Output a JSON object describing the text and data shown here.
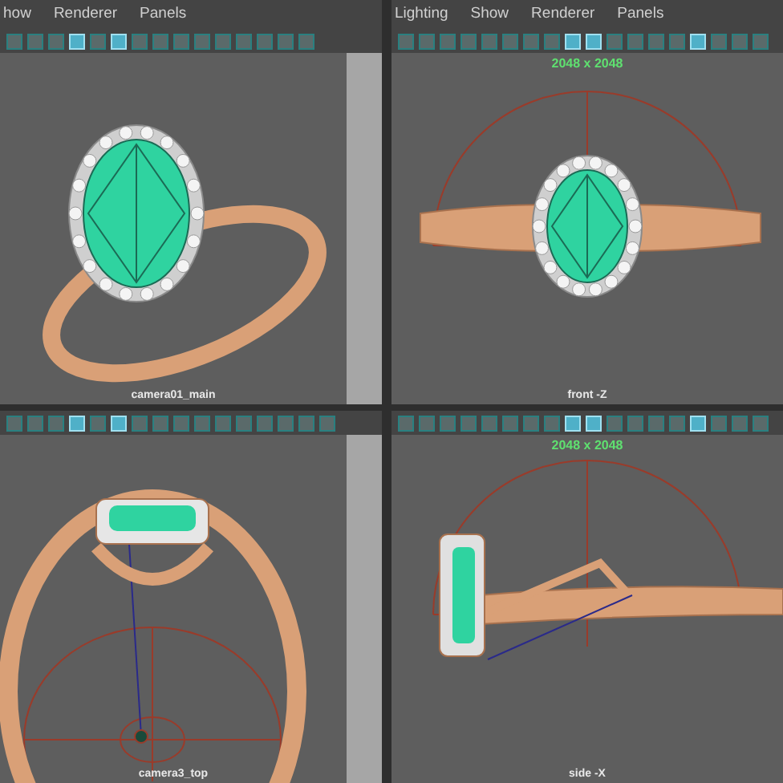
{
  "panels": [
    {
      "kind": "perspective",
      "menu": [
        "how",
        "Renderer",
        "Panels"
      ],
      "label": "camera01_main",
      "toolbar": [
        {
          "selected": false
        },
        {
          "selected": false
        },
        {
          "selected": false
        },
        {
          "selected": true
        },
        {
          "selected": false
        },
        {
          "selected": true
        },
        {
          "selected": false
        },
        {
          "selected": false
        },
        {
          "selected": false
        },
        {
          "selected": false
        },
        {
          "selected": false
        },
        {
          "selected": false
        },
        {
          "selected": false
        },
        {
          "selected": false
        },
        {
          "selected": false
        }
      ]
    },
    {
      "kind": "front",
      "menu": [
        "Lighting",
        "Show",
        "Renderer",
        "Panels"
      ],
      "label": "front -Z",
      "resolution": "2048 x 2048",
      "toolbar": [
        {
          "selected": false
        },
        {
          "selected": false
        },
        {
          "selected": false
        },
        {
          "selected": false
        },
        {
          "selected": false
        },
        {
          "selected": false
        },
        {
          "selected": false
        },
        {
          "selected": false
        },
        {
          "selected": true
        },
        {
          "selected": true
        },
        {
          "selected": false
        },
        {
          "selected": false
        },
        {
          "selected": false
        },
        {
          "selected": false
        },
        {
          "selected": true
        },
        {
          "selected": false
        },
        {
          "selected": false
        },
        {
          "selected": false
        }
      ]
    },
    {
      "kind": "top",
      "label": "camera3_top",
      "toolbar": [
        {
          "selected": false
        },
        {
          "selected": false
        },
        {
          "selected": false
        },
        {
          "selected": true
        },
        {
          "selected": false
        },
        {
          "selected": true
        },
        {
          "selected": false
        },
        {
          "selected": false
        },
        {
          "selected": false
        },
        {
          "selected": false
        },
        {
          "selected": false
        },
        {
          "selected": false
        },
        {
          "selected": false
        },
        {
          "selected": false
        },
        {
          "selected": false
        },
        {
          "selected": false
        }
      ]
    },
    {
      "kind": "side",
      "label": "side -X",
      "resolution": "2048 x 2048",
      "toolbar": [
        {
          "selected": false
        },
        {
          "selected": false
        },
        {
          "selected": false
        },
        {
          "selected": false
        },
        {
          "selected": false
        },
        {
          "selected": false
        },
        {
          "selected": false
        },
        {
          "selected": false
        },
        {
          "selected": true
        },
        {
          "selected": true
        },
        {
          "selected": false
        },
        {
          "selected": false
        },
        {
          "selected": false
        },
        {
          "selected": false
        },
        {
          "selected": true
        },
        {
          "selected": false
        },
        {
          "selected": false
        },
        {
          "selected": false
        }
      ]
    }
  ]
}
